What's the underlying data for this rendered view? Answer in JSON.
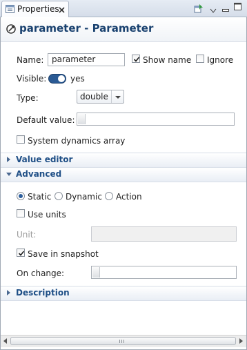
{
  "tab": {
    "title": "Properties"
  },
  "header": {
    "title": "parameter - Parameter"
  },
  "name_row": {
    "label": "Name:",
    "value": "parameter",
    "show_name_label": "Show name",
    "show_name_checked": true,
    "ignore_label": "Ignore",
    "ignore_checked": false
  },
  "visible_row": {
    "label": "Visible:",
    "value": "yes",
    "on": true
  },
  "type_row": {
    "label": "Type:",
    "selected": "double"
  },
  "default_row": {
    "label": "Default value:",
    "value": ""
  },
  "sd_array": {
    "label": "System dynamics array",
    "checked": false
  },
  "sections": {
    "value_editor": "Value editor",
    "advanced": "Advanced",
    "description": "Description"
  },
  "advanced": {
    "modes": [
      {
        "label": "Static",
        "selected": true
      },
      {
        "label": "Dynamic",
        "selected": false
      },
      {
        "label": "Action",
        "selected": false
      }
    ],
    "use_units_label": "Use units",
    "use_units_checked": false,
    "unit_label": "Unit:",
    "unit_value": "",
    "save_snapshot_label": "Save in snapshot",
    "save_snapshot_checked": true,
    "on_change_label": "On change:",
    "on_change_value": ""
  },
  "colors": {
    "section_text": "#1f4f86",
    "title_text": "#19416f",
    "toggle_on": "#2a5a94"
  }
}
